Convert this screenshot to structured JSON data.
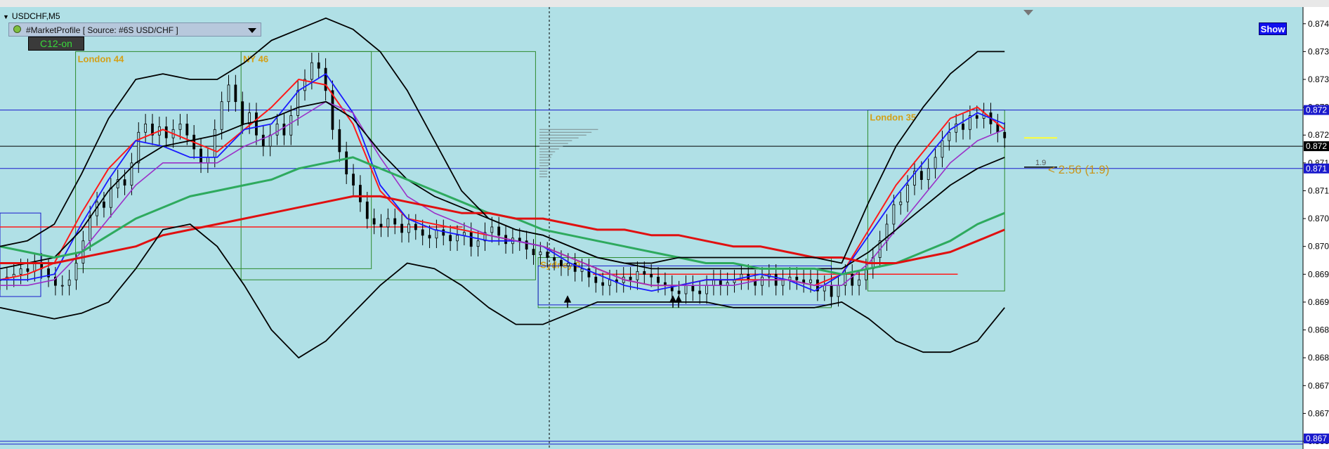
{
  "window": {
    "title": "USDCHF,M5"
  },
  "indicator_panel": {
    "label": "#MarketProfile [ Source: #6S USD/CHF ]"
  },
  "buttons": {
    "c12": "C12-on",
    "show": "Show"
  },
  "colors": {
    "background": "#b0e0e6",
    "session_box": "#2e8b2e",
    "session_label": "#d4a017",
    "ma_red_fast": "#ff1a1a",
    "ma_blue": "#1a1aff",
    "ma_purple": "#9b30c8",
    "ma_green": "#2eaa5e",
    "ma_red_slow": "#e01010",
    "bands": "#000000",
    "hline_blue": "#1a1acc",
    "hline_black": "#000000",
    "price_box_blue": "#1a1acc",
    "price_box_black": "#000000"
  },
  "chart_data": {
    "type": "candlestick",
    "symbol": "USDCHF",
    "timeframe": "M5",
    "ylim": [
      0.8665,
      0.8743
    ],
    "y_ticks": [
      "0.8740",
      "0.8735",
      "0.8730",
      "0.8725",
      "0.8720",
      "0.8715",
      "0.8710",
      "0.8705",
      "0.8700",
      "0.8695",
      "0.8690",
      "0.8685",
      "0.8680",
      "0.8675",
      "0.8670",
      "0.8665"
    ],
    "y_ticks_display": [
      "0.874",
      "0.873",
      "0.873",
      "0.872",
      "0.872",
      "0.871",
      "0.871",
      "0.870",
      "0.870",
      "0.869",
      "0.869",
      "0.868",
      "0.868",
      "0.867",
      "0.867",
      "0.866"
    ],
    "price_boxes": [
      {
        "value": 0.87245,
        "display": "0.872",
        "color": "blue"
      },
      {
        "value": 0.8718,
        "display": "0.872",
        "color": "black"
      },
      {
        "value": 0.8714,
        "display": "0.871",
        "color": "blue"
      },
      {
        "value": 0.86655,
        "display": "0.867",
        "color": "blue"
      }
    ],
    "horizontal_lines": [
      {
        "value": 0.87245,
        "color": "blue"
      },
      {
        "value": 0.8718,
        "color": "black"
      },
      {
        "value": 0.8714,
        "color": "blue"
      },
      {
        "value": 0.87035,
        "color": "red",
        "x_range": [
          0,
          0.355
        ]
      },
      {
        "value": 0.8695,
        "color": "red",
        "x_range": [
          0.455,
          0.735
        ]
      }
    ],
    "sessions": [
      {
        "label": "London 44",
        "x_range": [
          0.058,
          0.285
        ],
        "high": 0.8735,
        "low": 0.8696
      },
      {
        "label": "NY 46",
        "x_range": [
          0.185,
          0.411
        ],
        "high": 0.8735,
        "low": 0.8694
      },
      {
        "label": "Sydney 9",
        "x_range": [
          0.413,
          0.638
        ],
        "high": 0.8698,
        "low": 0.8689
      },
      {
        "label": "London 35",
        "x_range": [
          0.666,
          0.771
        ],
        "high": 0.87245,
        "low": 0.8692
      }
    ],
    "current_price": 0.87195,
    "candle_timer": "< 2:56 (1.9)",
    "spread": "1.9",
    "series": [
      {
        "name": "",
        "style": "candles",
        "x_range": [
          0.0,
          0.771
        ],
        "closes": [
          0.8694,
          0.86945,
          0.8695,
          0.8696,
          0.86955,
          0.8697,
          0.8696,
          0.86945,
          0.8693,
          0.8693,
          0.8694,
          0.8697,
          0.8701,
          0.87055,
          0.8708,
          0.8707,
          0.87105,
          0.8712,
          0.8711,
          0.8715,
          0.87205,
          0.8722,
          0.872,
          0.87215,
          0.87195,
          0.8721,
          0.8722,
          0.872,
          0.87175,
          0.8715,
          0.8716,
          0.8721,
          0.8726,
          0.8729,
          0.8726,
          0.8722,
          0.8724,
          0.872,
          0.8718,
          0.872,
          0.8722,
          0.872,
          0.87235,
          0.8728,
          0.873,
          0.8733,
          0.8732,
          0.8728,
          0.8721,
          0.8717,
          0.8713,
          0.8711,
          0.8708,
          0.8705,
          0.8704,
          0.87035,
          0.8705,
          0.8704,
          0.87025,
          0.8704,
          0.8703,
          0.8702,
          0.87015,
          0.8703,
          0.8702,
          0.8701,
          0.8702,
          0.87025,
          0.87,
          0.8701,
          0.87025,
          0.87035,
          0.8702,
          0.87005,
          0.87015,
          0.8701,
          0.86995,
          0.86985,
          0.8699,
          0.8698,
          0.86975,
          0.86965,
          0.8697,
          0.86955,
          0.8696,
          0.86945,
          0.86935,
          0.8693,
          0.8694,
          0.86935,
          0.86945,
          0.8694,
          0.86955,
          0.8695,
          0.86945,
          0.86935,
          0.8693,
          0.8692,
          0.86915,
          0.8693,
          0.8692,
          0.86915,
          0.8693,
          0.8694,
          0.8693,
          0.86935,
          0.8694,
          0.8695,
          0.8694,
          0.8693,
          0.86945,
          0.8695,
          0.8693,
          0.8694,
          0.86945,
          0.8694,
          0.86935,
          0.8694,
          0.8692,
          0.8693,
          0.8691,
          0.8693,
          0.8695,
          0.8693,
          0.8694,
          0.8696,
          0.8698,
          0.8701,
          0.8704,
          0.87075,
          0.8708,
          0.8711,
          0.87135,
          0.8712,
          0.8714,
          0.8716,
          0.8719,
          0.87205,
          0.8722,
          0.8721,
          0.87235,
          0.8723,
          0.8724,
          0.8722,
          0.87205,
          0.87195
        ]
      },
      {
        "name": "",
        "style": "line",
        "color": "ma_red_fast",
        "x_range": [
          0.0,
          0.771
        ],
        "values": [
          0.8694,
          0.8695,
          0.8697,
          0.8706,
          0.8714,
          0.8719,
          0.8721,
          0.8719,
          0.8717,
          0.8721,
          0.8725,
          0.873,
          0.8729,
          0.8722,
          0.871,
          0.8705,
          0.8704,
          0.8703,
          0.8702,
          0.8701,
          0.87,
          0.8698,
          0.8696,
          0.8694,
          0.8693,
          0.8693,
          0.8694,
          0.8694,
          0.8694,
          0.8694,
          0.8693,
          0.8695,
          0.8703,
          0.8711,
          0.8717,
          0.8723,
          0.8725,
          0.8721
        ]
      },
      {
        "name": "",
        "style": "line",
        "color": "ma_blue",
        "x_range": [
          0.0,
          0.771
        ],
        "values": [
          0.8694,
          0.8694,
          0.8695,
          0.8704,
          0.8712,
          0.8719,
          0.8718,
          0.8716,
          0.8716,
          0.8721,
          0.8722,
          0.8728,
          0.8731,
          0.8724,
          0.8711,
          0.8705,
          0.8703,
          0.8702,
          0.8701,
          0.8701,
          0.87,
          0.8697,
          0.8695,
          0.8693,
          0.8692,
          0.8693,
          0.8694,
          0.8694,
          0.8695,
          0.8694,
          0.8692,
          0.8695,
          0.8702,
          0.8709,
          0.8715,
          0.8721,
          0.8724,
          0.8722
        ]
      },
      {
        "name": "",
        "style": "line",
        "color": "ma_purple",
        "x_range": [
          0.0,
          0.771
        ],
        "values": [
          0.8693,
          0.8693,
          0.8694,
          0.8699,
          0.8705,
          0.8711,
          0.8715,
          0.8715,
          0.8715,
          0.8718,
          0.872,
          0.8723,
          0.8726,
          0.8724,
          0.8716,
          0.8709,
          0.8706,
          0.8704,
          0.8702,
          0.8701,
          0.87,
          0.8698,
          0.8696,
          0.8694,
          0.8693,
          0.8693,
          0.8693,
          0.8693,
          0.8694,
          0.8694,
          0.8693,
          0.8693,
          0.8697,
          0.8703,
          0.8709,
          0.8715,
          0.8719,
          0.8721
        ]
      },
      {
        "name": "",
        "style": "line",
        "color": "bands",
        "x_range": [
          0.0,
          0.771
        ],
        "values": [
          0.8696,
          0.8697,
          0.8698,
          0.8703,
          0.871,
          0.8715,
          0.8718,
          0.8719,
          0.872,
          0.8722,
          0.8723,
          0.8725,
          0.8726,
          0.8723,
          0.8717,
          0.8712,
          0.8709,
          0.8707,
          0.8705,
          0.8703,
          0.8702,
          0.87,
          0.8698,
          0.8697,
          0.8696,
          0.8696,
          0.8696,
          0.8696,
          0.8696,
          0.8696,
          0.8696,
          0.8696,
          0.8699,
          0.8703,
          0.8707,
          0.8711,
          0.8714,
          0.8716
        ]
      },
      {
        "name": "",
        "style": "line",
        "color": "ma_green",
        "x_range": [
          0.0,
          0.771
        ],
        "values": [
          0.87,
          0.8699,
          0.8698,
          0.8699,
          0.8702,
          0.8705,
          0.8707,
          0.8709,
          0.871,
          0.8711,
          0.8712,
          0.8714,
          0.8715,
          0.8716,
          0.8714,
          0.8712,
          0.871,
          0.8708,
          0.8706,
          0.8705,
          0.8703,
          0.8702,
          0.8701,
          0.87,
          0.8699,
          0.8698,
          0.8697,
          0.8697,
          0.8696,
          0.8696,
          0.8696,
          0.8695,
          0.8696,
          0.8697,
          0.8699,
          0.8701,
          0.8704,
          0.8706
        ]
      },
      {
        "name": "",
        "style": "line",
        "color": "ma_red_slow",
        "x_range": [
          0.0,
          0.771
        ],
        "values": [
          0.8697,
          0.8697,
          0.8697,
          0.8698,
          0.8699,
          0.87,
          0.8702,
          0.8703,
          0.8704,
          0.8705,
          0.8706,
          0.8707,
          0.8708,
          0.8709,
          0.8709,
          0.8708,
          0.8707,
          0.8706,
          0.8706,
          0.8705,
          0.8705,
          0.8704,
          0.8703,
          0.8703,
          0.8702,
          0.8702,
          0.8701,
          0.87,
          0.87,
          0.8699,
          0.8698,
          0.8698,
          0.8697,
          0.8697,
          0.8698,
          0.8699,
          0.8701,
          0.8703
        ]
      },
      {
        "name": "",
        "style": "line",
        "color": "bands",
        "x_range": [
          0.0,
          0.771
        ],
        "values": [
          0.87,
          0.8701,
          0.8704,
          0.8713,
          0.8723,
          0.873,
          0.8731,
          0.873,
          0.873,
          0.8733,
          0.8737,
          0.8739,
          0.8741,
          0.8739,
          0.8735,
          0.8728,
          0.8719,
          0.871,
          0.8705,
          0.8703,
          0.8702,
          0.87,
          0.8698,
          0.8697,
          0.8697,
          0.8698,
          0.8698,
          0.8698,
          0.8698,
          0.8698,
          0.8698,
          0.8697,
          0.8708,
          0.8718,
          0.8725,
          0.8731,
          0.8735,
          0.8735
        ]
      },
      {
        "name": "",
        "style": "line",
        "color": "bands",
        "x_range": [
          0.0,
          0.771
        ],
        "values": [
          0.8689,
          0.8688,
          0.8687,
          0.8688,
          0.869,
          0.8696,
          0.8703,
          0.8704,
          0.87,
          0.8693,
          0.8685,
          0.868,
          0.8683,
          0.8688,
          0.8693,
          0.8697,
          0.8696,
          0.8693,
          0.8689,
          0.8686,
          0.8686,
          0.8688,
          0.869,
          0.869,
          0.869,
          0.869,
          0.869,
          0.8689,
          0.8689,
          0.8689,
          0.8689,
          0.869,
          0.8687,
          0.8683,
          0.8681,
          0.8681,
          0.8683,
          0.8689
        ]
      }
    ],
    "volume_profile": {
      "x_start": 0.414,
      "levels": [
        {
          "price": 0.8721,
          "length": 0.045
        },
        {
          "price": 0.87205,
          "length": 0.04
        },
        {
          "price": 0.872,
          "length": 0.036
        },
        {
          "price": 0.87195,
          "length": 0.03
        },
        {
          "price": 0.8719,
          "length": 0.025
        },
        {
          "price": 0.87185,
          "length": 0.022
        },
        {
          "price": 0.8718,
          "length": 0.018
        },
        {
          "price": 0.87175,
          "length": 0.015
        },
        {
          "price": 0.8717,
          "length": 0.012
        },
        {
          "price": 0.87165,
          "length": 0.01
        },
        {
          "price": 0.8716,
          "length": 0.009
        },
        {
          "price": 0.87155,
          "length": 0.008
        },
        {
          "price": 0.8715,
          "length": 0.008
        },
        {
          "price": 0.87145,
          "length": 0.007
        },
        {
          "price": 0.8714,
          "length": 0.007
        },
        {
          "price": 0.87135,
          "length": 0.006
        },
        {
          "price": 0.8713,
          "length": 0.006
        },
        {
          "price": 0.87125,
          "length": 0.006
        }
      ]
    }
  }
}
